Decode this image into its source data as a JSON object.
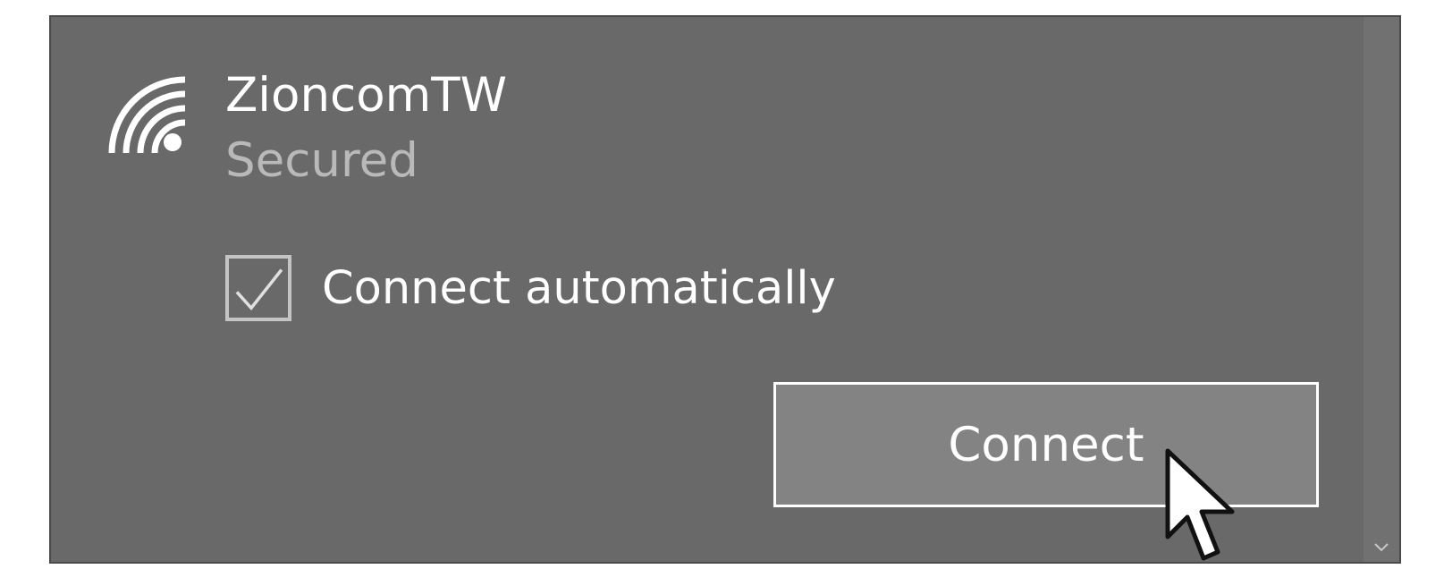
{
  "network": {
    "name": "ZioncomTW",
    "status": "Secured",
    "icon": "wifi-secured-icon"
  },
  "auto_connect": {
    "label": "Connect automatically",
    "checked": true
  },
  "actions": {
    "connect_label": "Connect"
  },
  "colors": {
    "panel_bg": "#6a6969",
    "button_bg": "#848383",
    "text_primary": "#ffffff",
    "text_secondary": "#b9b9b9"
  }
}
